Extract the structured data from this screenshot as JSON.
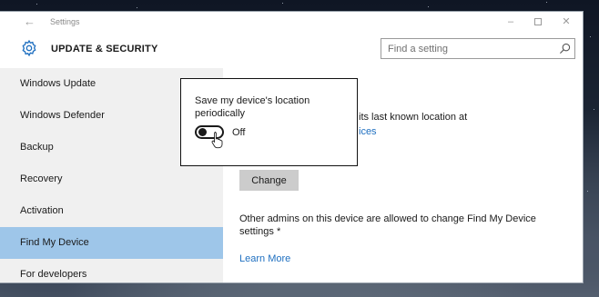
{
  "window": {
    "title": "Settings",
    "back_glyph": "←",
    "minimize_glyph": "–",
    "close_glyph": "✕"
  },
  "header": {
    "icon": "gear-icon",
    "title": "UPDATE & SECURITY",
    "search": {
      "placeholder": "Find a setting",
      "value": ""
    },
    "accent_color": "#1e6fc0"
  },
  "sidebar": {
    "active_color": "#9ec6e9",
    "items": [
      {
        "label": "Windows Update",
        "active": false
      },
      {
        "label": "Windows Defender",
        "active": false
      },
      {
        "label": "Backup",
        "active": false
      },
      {
        "label": "Recovery",
        "active": false
      },
      {
        "label": "Activation",
        "active": false
      },
      {
        "label": "Find My Device",
        "active": true
      },
      {
        "label": "For developers",
        "active": false
      }
    ]
  },
  "main": {
    "description_fragment": "its last known location at",
    "link_fragment": "ices",
    "change_button": "Change",
    "admins_note": "Other admins on this device are allowed to change Find My Device settings *",
    "learn_more": "Learn More"
  },
  "popup": {
    "label": "Save my device's location periodically",
    "toggle_state": "Off",
    "toggle_on": false
  }
}
